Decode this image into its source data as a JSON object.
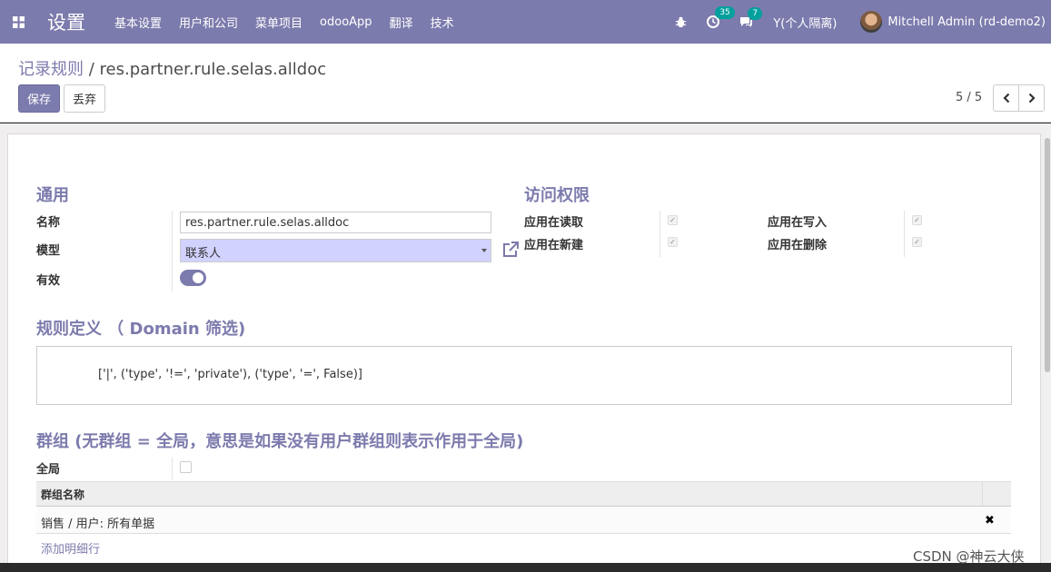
{
  "navbar": {
    "brand": "设置",
    "menu": [
      "基本设置",
      "用户和公司",
      "菜单项目",
      "odooApp",
      "翻译",
      "技术"
    ],
    "activity_count": "35",
    "message_count": "7",
    "company": "Y(个人隔离)",
    "user": "Mitchell Admin (rd-demo2)"
  },
  "control": {
    "breadcrumb_parent": "记录规则",
    "breadcrumb_sep": " / ",
    "breadcrumb_current": "res.partner.rule.selas.alldoc",
    "save_label": "保存",
    "discard_label": "丢弃",
    "pager": "5 / 5"
  },
  "general": {
    "title": "通用",
    "name_label": "名称",
    "name_value": "res.partner.rule.selas.alldoc",
    "model_label": "模型",
    "model_value": "联系人",
    "active_label": "有效",
    "active": true
  },
  "access": {
    "title": "访问权限",
    "read_label": "应用在读取",
    "create_label": "应用在新建",
    "write_label": "应用在写入",
    "unlink_label": "应用在删除",
    "read": true,
    "create": true,
    "write": true,
    "unlink": true
  },
  "domain": {
    "title": "规则定义 （ Domain 筛选)",
    "value": "['|', ('type', '!=', 'private'), ('type', '=', False)]"
  },
  "groups": {
    "title": "群组 (无群组 = 全局，意思是如果没有用户群组则表示作用于全局)",
    "global_label": "全局",
    "global": false,
    "column_header": "群组名称",
    "rows": [
      "销售 / 用户: 所有单据"
    ],
    "add_line": "添加明细行"
  },
  "watermark": "CSDN @神云大侠",
  "colors": {
    "brand": "#7c7bad",
    "model_highlight": "#d2d2ff",
    "badge": "#00a09d"
  }
}
